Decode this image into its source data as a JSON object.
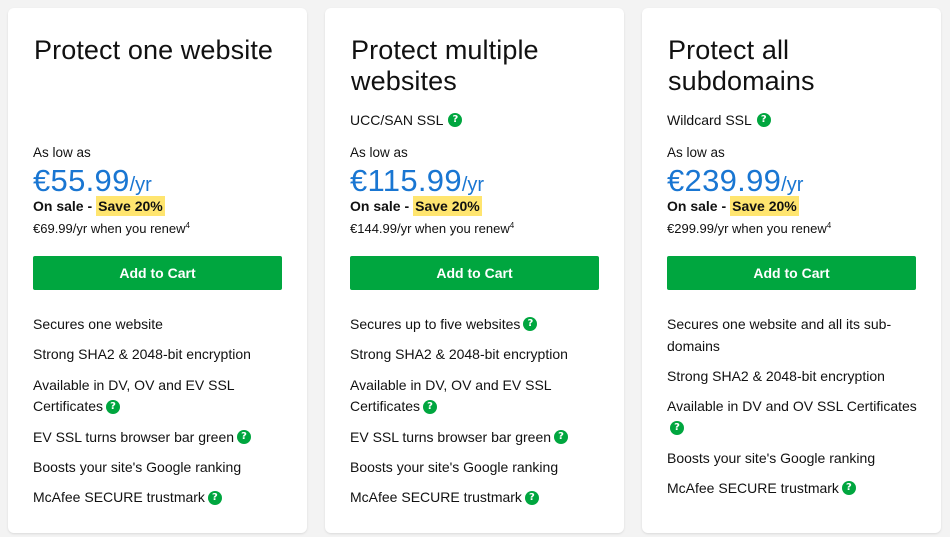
{
  "plans": [
    {
      "title": "Protect one website",
      "subtitle": "",
      "subtitle_help": false,
      "as_low_as": "As low as",
      "price": "€55.99",
      "unit": "/yr",
      "on_sale": "On sale -",
      "save": "Save 20%",
      "renew": "€69.99/yr when you renew",
      "renew_note": "4",
      "cta": "Add to Cart",
      "features": [
        {
          "text": "Secures one website",
          "help": false
        },
        {
          "text": "Strong SHA2 & 2048-bit encryption",
          "help": false
        },
        {
          "text": "Available in DV, OV and EV SSL Certificates",
          "help": true
        },
        {
          "text": "EV SSL turns browser bar green",
          "help": true
        },
        {
          "text": "Boosts your site's Google ranking",
          "help": false
        },
        {
          "text": "McAfee SECURE trustmark",
          "help": true
        }
      ]
    },
    {
      "title": "Protect multiple websites",
      "subtitle": "UCC/SAN SSL",
      "subtitle_help": true,
      "as_low_as": "As low as",
      "price": "€115.99",
      "unit": "/yr",
      "on_sale": "On sale -",
      "save": "Save 20%",
      "renew": "€144.99/yr when you renew",
      "renew_note": "4",
      "cta": "Add to Cart",
      "features": [
        {
          "text": "Secures up to five websites",
          "help": true
        },
        {
          "text": "Strong SHA2 & 2048-bit encryption",
          "help": false
        },
        {
          "text": "Available in DV, OV and EV SSL Certificates",
          "help": true
        },
        {
          "text": "EV SSL turns browser bar green",
          "help": true
        },
        {
          "text": "Boosts your site's Google ranking",
          "help": false
        },
        {
          "text": "McAfee SECURE trustmark",
          "help": true
        }
      ]
    },
    {
      "title": "Protect all subdomains",
      "subtitle": "Wildcard SSL",
      "subtitle_help": true,
      "as_low_as": "As low as",
      "price": "€239.99",
      "unit": "/yr",
      "on_sale": "On sale -",
      "save": "Save 20%",
      "renew": "€299.99/yr when you renew",
      "renew_note": "4",
      "cta": "Add to Cart",
      "features": [
        {
          "text": "Secures one website and all its sub-domains",
          "help": false
        },
        {
          "text": "Strong SHA2 & 2048-bit encryption",
          "help": false
        },
        {
          "text": "Available in DV and OV SSL Certificates",
          "help": true
        },
        {
          "text": "Boosts your site's Google ranking",
          "help": false
        },
        {
          "text": "McAfee SECURE trustmark",
          "help": true
        }
      ]
    }
  ],
  "icons": {
    "help": "question-circle-icon",
    "help_glyph": "?"
  },
  "colors": {
    "accent": "#00a63f",
    "price": "#1976d2",
    "highlight": "#ffe56f"
  }
}
